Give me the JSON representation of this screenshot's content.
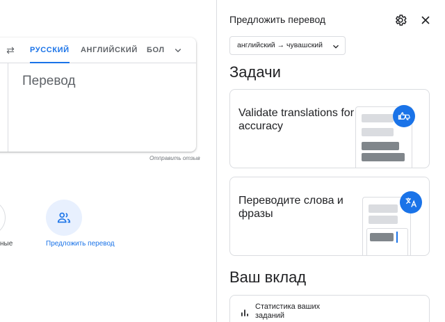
{
  "translator": {
    "tabs": [
      "РУССКИЙ",
      "АНГЛИЙСКИЙ",
      "БОЛ"
    ],
    "output_placeholder": "Перевод",
    "feedback_link": "Отправить отзыв"
  },
  "actions": {
    "saved_label": "ные",
    "suggest_label": "Предложить перевод"
  },
  "panel": {
    "title": "Предложить перевод",
    "language_pair": "английский → чувашский",
    "tasks_heading": "Задачи",
    "tasks": [
      {
        "title": "Validate translations for accuracy"
      },
      {
        "title": "Переводите слова и фразы"
      }
    ],
    "contribution_heading": "Ваш вклад",
    "stats_label": "Статистика ваших заданий"
  },
  "colors": {
    "accent": "#1a73e8",
    "badge_bg": "#e8f0fe",
    "bar_light": "#dadce0",
    "bar_dark": "#80868b"
  }
}
